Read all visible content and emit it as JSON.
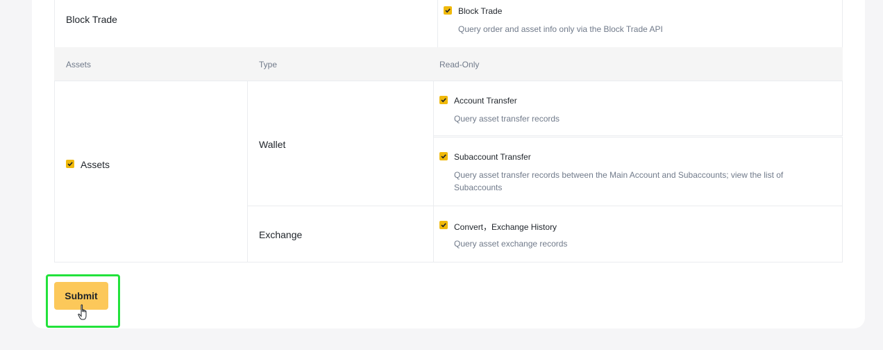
{
  "block_trade": {
    "row_label": "Block Trade",
    "option": {
      "label": "Block Trade",
      "description": "Query order and asset info only via the Block Trade API",
      "checked": true
    }
  },
  "table_header": {
    "col1": "Assets",
    "col2": "Type",
    "col3": "Read-Only"
  },
  "assets": {
    "label": "Assets",
    "checked": true,
    "wallet": {
      "type": "Wallet",
      "options": [
        {
          "label": "Account Transfer",
          "description": "Query asset transfer records",
          "checked": true
        },
        {
          "label": "Subaccount Transfer",
          "description_line1": "Query asset transfer records between the Main Account and Subaccounts; view the list of",
          "description_line2": "Subaccounts",
          "checked": true
        }
      ]
    },
    "exchange": {
      "type": "Exchange",
      "options": [
        {
          "label": "Convert，Exchange History",
          "description": "Query asset exchange records",
          "checked": true
        }
      ]
    }
  },
  "submit": {
    "label": "Submit"
  },
  "colors": {
    "checkbox": "#f0b90b",
    "submit_bg": "#fcc85a",
    "highlight": "#22e23b"
  },
  "icons": {
    "checkbox": "checkmark-icon",
    "cursor": "hand-pointer-icon"
  }
}
